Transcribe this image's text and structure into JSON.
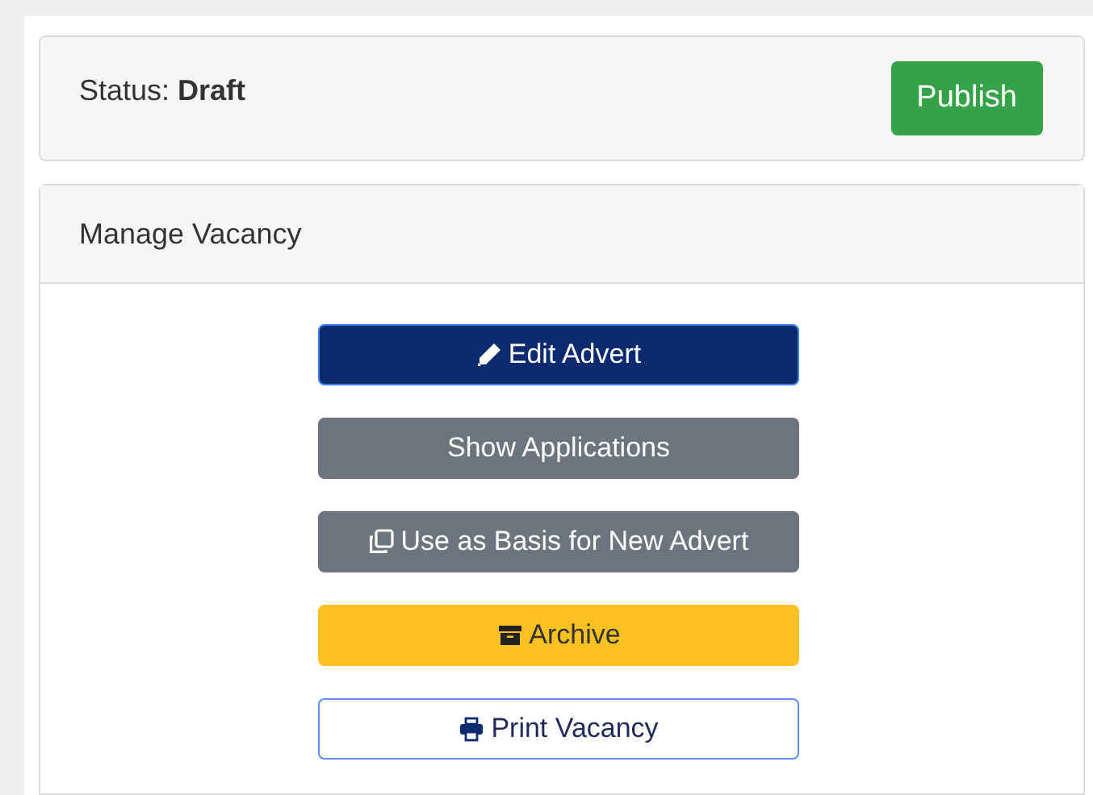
{
  "status_card": {
    "text": "Status: **Draft**",
    "publish_button": "Publish"
  },
  "manage_card": {
    "title": "Manage Vacancy",
    "buttons": [
      {
        "label": "Edit Advert",
        "kind": "primary"
      },
      {
        "label": "Show Applications",
        "kind": "secondary"
      },
      {
        "label": "Use as Basis for New Advert",
        "kind": "secondary"
      },
      {
        "label": "Archive",
        "kind": "warning"
      },
      {
        "label": "Print Vacancy",
        "kind": "outline"
      }
    ]
  }
}
